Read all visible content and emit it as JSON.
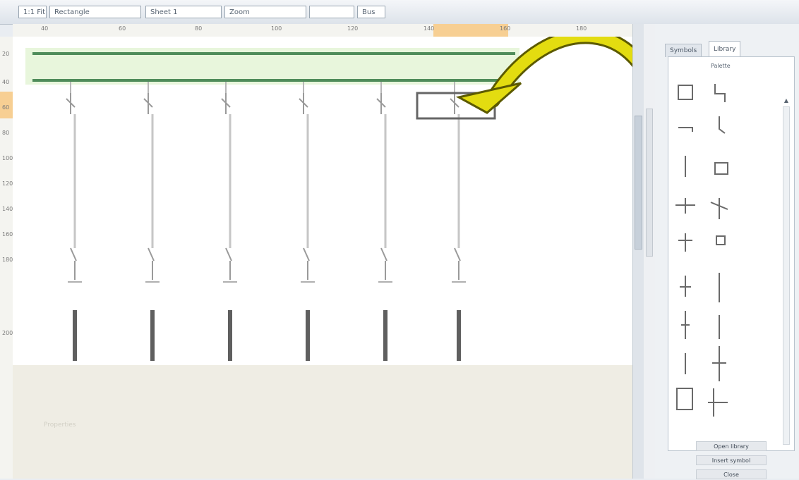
{
  "toolbar": {
    "fields": [
      "1:1 Fit",
      "Rectangle",
      "Sheet 1",
      "Zoom",
      "",
      "Bus"
    ]
  },
  "ruler": {
    "top": [
      "40",
      "60",
      "80",
      "100",
      "120",
      "140",
      "160",
      "180"
    ],
    "left": [
      "20",
      "40",
      "60",
      "80",
      "100",
      "120",
      "140",
      "160",
      "180",
      "200"
    ]
  },
  "arrow_color": "#e3dc10",
  "bus_color": "#4f8c5a",
  "panel": {
    "tabs": [
      "Symbols",
      "Library"
    ],
    "palette_title": "Palette",
    "buttons": [
      "Open library",
      "Insert symbol",
      "Close"
    ]
  },
  "lower": {
    "faint_text": "Properties"
  }
}
